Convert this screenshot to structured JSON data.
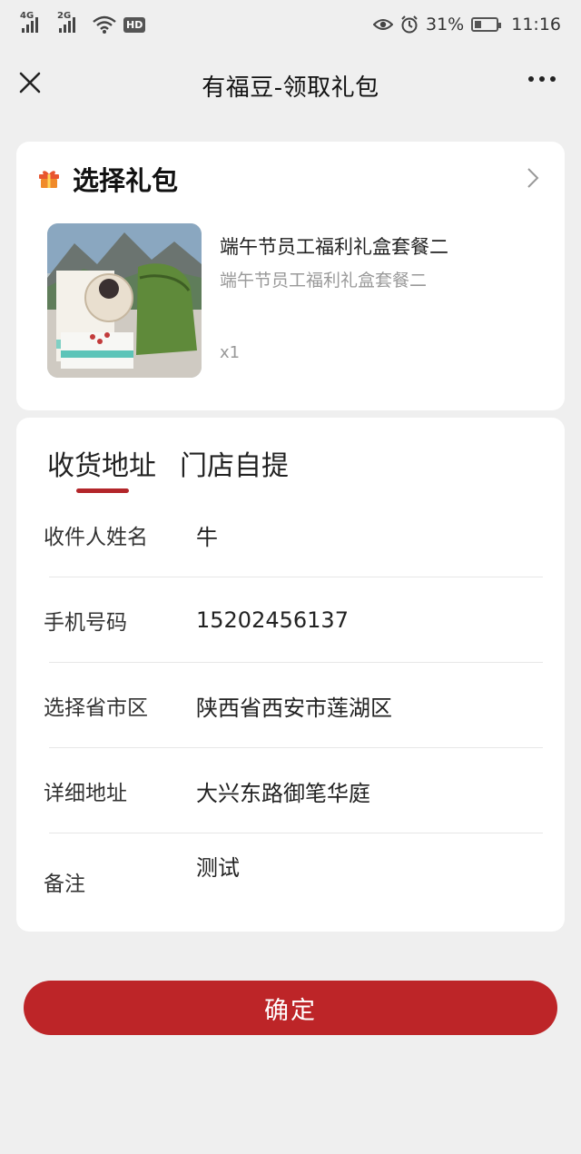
{
  "status_bar": {
    "signal1_label": "4G",
    "signal2_label": "2G",
    "hd_badge": "HD",
    "battery_percent": "31%",
    "battery_level": 0.31,
    "time": "11:16",
    "icons": [
      "signal-icon",
      "wifi-icon",
      "eye-icon",
      "alarm-icon",
      "battery-icon"
    ]
  },
  "navbar": {
    "title": "有福豆-领取礼包",
    "close_icon": "close-icon",
    "more_icon": "more-icon"
  },
  "gift": {
    "section_title": "选择礼包",
    "section_icon": "gift-icon",
    "chevron_icon": "chevron-right-icon",
    "product_name": "端午节员工福利礼盒套餐二",
    "product_subtitle": "端午节员工福利礼盒套餐二",
    "quantity": "x1"
  },
  "address": {
    "tabs": [
      "收货地址",
      "门店自提"
    ],
    "active_tab": 0,
    "fields": [
      {
        "label": "收件人姓名",
        "value": "牛"
      },
      {
        "label": "手机号码",
        "value": "15202456137"
      },
      {
        "label": "选择省市区",
        "value": "陕西省西安市莲湖区"
      },
      {
        "label": "详细地址",
        "value": "大兴东路御笔华庭"
      },
      {
        "label": "备注",
        "value": "测试"
      }
    ]
  },
  "confirm_label": "确定",
  "colors": {
    "accent": "#bd2528",
    "background": "#efefef",
    "card": "#ffffff"
  }
}
